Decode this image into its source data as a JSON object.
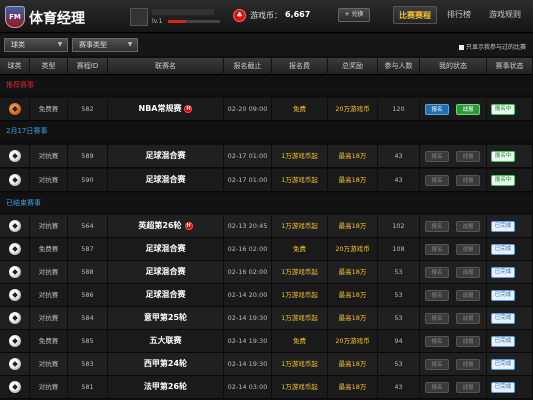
{
  "header": {
    "logo_text": "FM",
    "brand": "体育经理",
    "user_level": "lv.1",
    "user_progress_fraction": 0.35,
    "coin_label": "游戏币：",
    "coin_value": "6,667",
    "exchange_label": "+ 兑换",
    "nav": [
      "比赛赛程",
      "排行榜",
      "游戏规则"
    ]
  },
  "filters": {
    "type_select": "球类",
    "match_type_select": "赛事类型",
    "only_joined_label": "只显示我参与过的比赛"
  },
  "table": {
    "columns": [
      "球类",
      "类型",
      "赛程ID",
      "联赛名",
      "报名截止",
      "报名费",
      "总奖励",
      "参与人数",
      "我的状态",
      "赛事状态"
    ]
  },
  "sections": [
    {
      "title": "推荐赛事",
      "color": "#d32a2a"
    },
    {
      "title": "2月17日赛事",
      "color": "#39a3e8"
    },
    {
      "title": "已结束赛事",
      "color": "#39a3e8"
    }
  ],
  "rows": [
    {
      "sport": "basketball",
      "type": "免费赛",
      "id": "582",
      "league": "NBA常规赛",
      "hot": true,
      "deadline": "02-20 09:00",
      "fee": "免费",
      "prize": "20万游戏币",
      "players": "120",
      "my_status": [
        "报名",
        "战报"
      ],
      "status_active": true,
      "event_status": "报名中"
    },
    {
      "sport": "football",
      "type": "对抗赛",
      "id": "589",
      "league": "足球混合赛",
      "hot": false,
      "deadline": "02-17 01:00",
      "fee": "1万游戏币起",
      "prize": "最高18万",
      "players": "43",
      "my_status": [
        "报名",
        "战报"
      ],
      "status_active": false,
      "event_status": "报名中"
    },
    {
      "sport": "football",
      "type": "对抗赛",
      "id": "590",
      "league": "足球混合赛",
      "hot": false,
      "deadline": "02-17 01:00",
      "fee": "1万游戏币起",
      "prize": "最高18万",
      "players": "43",
      "my_status": [
        "报名",
        "战报"
      ],
      "status_active": false,
      "event_status": "报名中"
    },
    {
      "sport": "football",
      "type": "对抗赛",
      "id": "564",
      "league": "英超第26轮",
      "hot": true,
      "deadline": "02-13 20:45",
      "fee": "1万游戏币起",
      "prize": "最高18万",
      "players": "102",
      "my_status": [
        "报名",
        "战报"
      ],
      "status_active": false,
      "event_status": "已完成"
    },
    {
      "sport": "football",
      "type": "免费赛",
      "id": "587",
      "league": "足球混合赛",
      "hot": false,
      "deadline": "02-16 02:00",
      "fee": "免费",
      "prize": "20万游戏币",
      "players": "108",
      "my_status": [
        "报名",
        "战报"
      ],
      "status_active": false,
      "event_status": "已完成"
    },
    {
      "sport": "football",
      "type": "对抗赛",
      "id": "588",
      "league": "足球混合赛",
      "hot": false,
      "deadline": "02-16 02:00",
      "fee": "1万游戏币起",
      "prize": "最高18万",
      "players": "53",
      "my_status": [
        "报名",
        "战报"
      ],
      "status_active": false,
      "event_status": "已完成"
    },
    {
      "sport": "football",
      "type": "对抗赛",
      "id": "586",
      "league": "足球混合赛",
      "hot": false,
      "deadline": "02-14 20:00",
      "fee": "1万游戏币起",
      "prize": "最高18万",
      "players": "53",
      "my_status": [
        "报名",
        "战报"
      ],
      "status_active": false,
      "event_status": "已完成"
    },
    {
      "sport": "football",
      "type": "对抗赛",
      "id": "584",
      "league": "意甲第25轮",
      "hot": false,
      "deadline": "02-14 19:30",
      "fee": "1万游戏币起",
      "prize": "最高18万",
      "players": "53",
      "my_status": [
        "报名",
        "战报"
      ],
      "status_active": false,
      "event_status": "已完成"
    },
    {
      "sport": "football",
      "type": "免费赛",
      "id": "585",
      "league": "五大联赛",
      "hot": false,
      "deadline": "02-14 19:30",
      "fee": "免费",
      "prize": "20万游戏币",
      "players": "94",
      "my_status": [
        "报名",
        "战报"
      ],
      "status_active": false,
      "event_status": "已完成"
    },
    {
      "sport": "football",
      "type": "对抗赛",
      "id": "583",
      "league": "西甲第24轮",
      "hot": false,
      "deadline": "02-14 19:30",
      "fee": "1万游戏币起",
      "prize": "最高18万",
      "players": "53",
      "my_status": [
        "报名",
        "战报"
      ],
      "status_active": false,
      "event_status": "已完成"
    },
    {
      "sport": "football",
      "type": "对抗赛",
      "id": "581",
      "league": "法甲第26轮",
      "hot": false,
      "deadline": "02-14 03:00",
      "fee": "1万游戏币起",
      "prize": "最高18万",
      "players": "43",
      "my_status": [
        "报名",
        "战报"
      ],
      "status_active": false,
      "event_status": "已完成"
    }
  ]
}
